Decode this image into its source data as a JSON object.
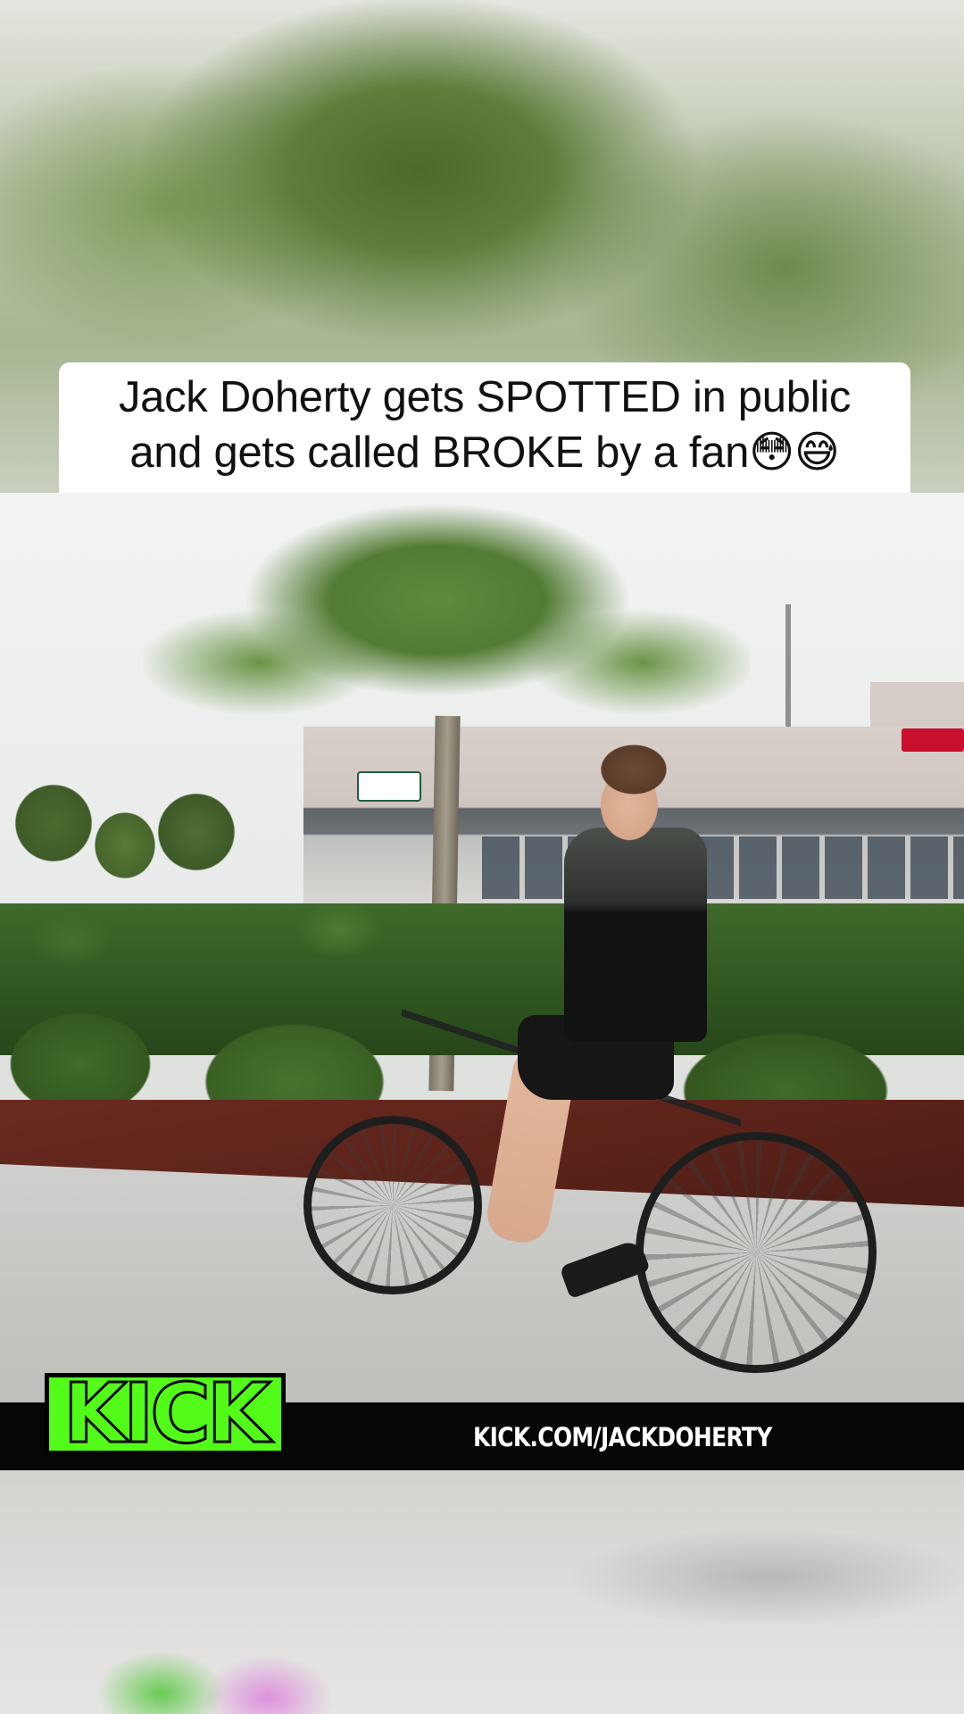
{
  "post": {
    "caption_line1": "Jack Doherty gets SPOTTED in public",
    "caption_line2": "and gets called BROKE by a fan😳😅"
  },
  "banner": {
    "logo_text": "KICK",
    "url_text": "KICK.COM/JACKDOHERTY",
    "accent_color": "#53fc18",
    "background_color": "#060606"
  },
  "icons": {
    "kick-logo": "green KICK wordmark"
  }
}
